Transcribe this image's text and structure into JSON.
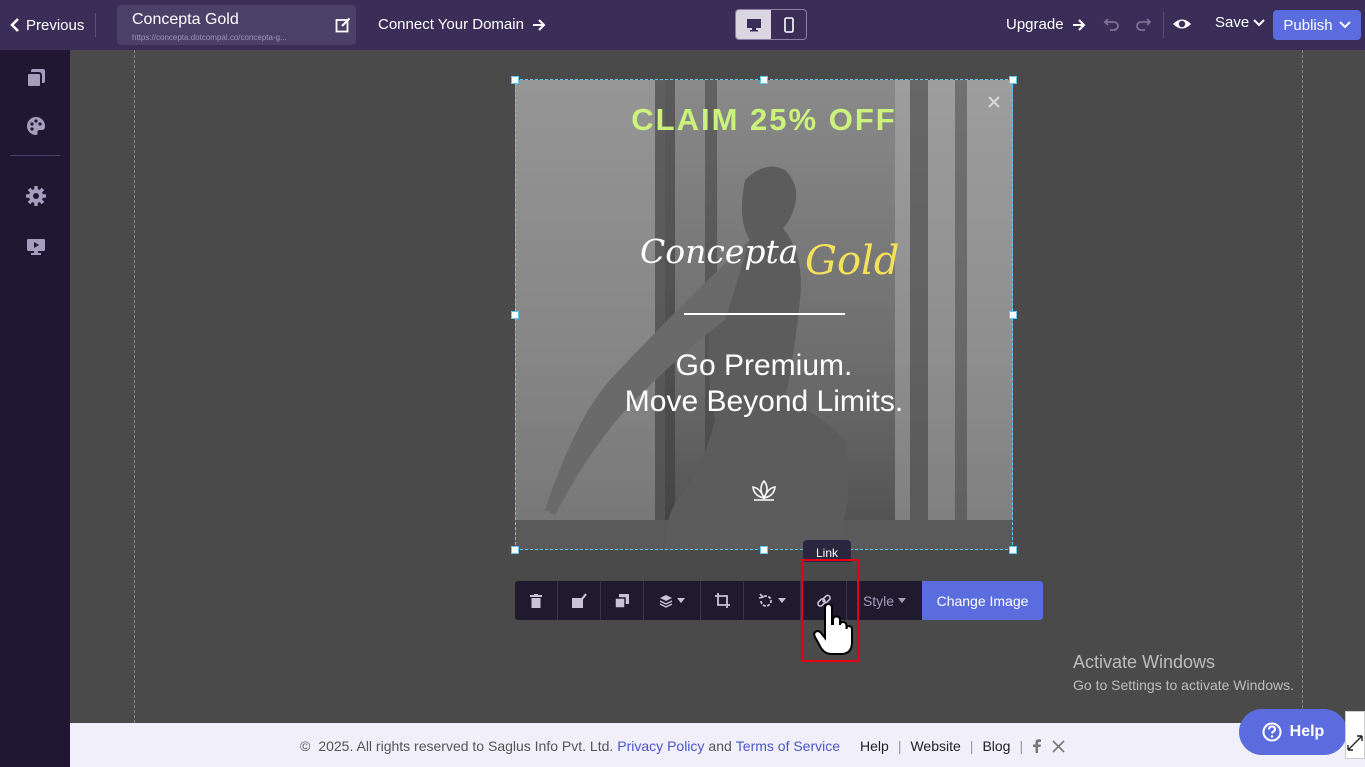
{
  "topbar": {
    "previous_label": "Previous",
    "site_name": "Concepta Gold",
    "site_url": "https://concepta.dotcompal.co/concepta-g...",
    "connect_domain_label": "Connect Your Domain",
    "upgrade_label": "Upgrade",
    "save_label": "Save",
    "publish_label": "Publish",
    "device_mode": "desktop"
  },
  "sidebar": {
    "items": [
      "pages-icon",
      "palette-icon",
      "gear-icon",
      "monitor-play-icon"
    ]
  },
  "banner": {
    "claim": "CLAIM 25% OFF",
    "brand_part1": "Concepta",
    "brand_part2": "Gold",
    "tagline_line1": "Go Premium.",
    "tagline_line2": "Move Beyond Limits."
  },
  "toolbar": {
    "tooltip": "Link",
    "style_label": "Style",
    "change_image_label": "Change Image"
  },
  "watermark": {
    "title": "Activate Windows",
    "subtitle": "Go to Settings to activate Windows."
  },
  "footer": {
    "copyright_symbol": "©",
    "copyright_text": "2025. All rights reserved to Saglus Info Pvt. Ltd.",
    "privacy": "Privacy Policy",
    "and": "and",
    "terms": "Terms of Service",
    "help": "Help",
    "website": "Website",
    "blog": "Blog"
  },
  "help_button_label": "Help",
  "colors": {
    "topbar_bg": "#3a2e59",
    "sidebar_bg": "#201832",
    "canvas_bg": "#4a4a4a",
    "accent": "#5b6cde",
    "claim_green": "#cbf27a",
    "brand_gold": "#f3e15a",
    "highlight_red": "#e60012"
  }
}
